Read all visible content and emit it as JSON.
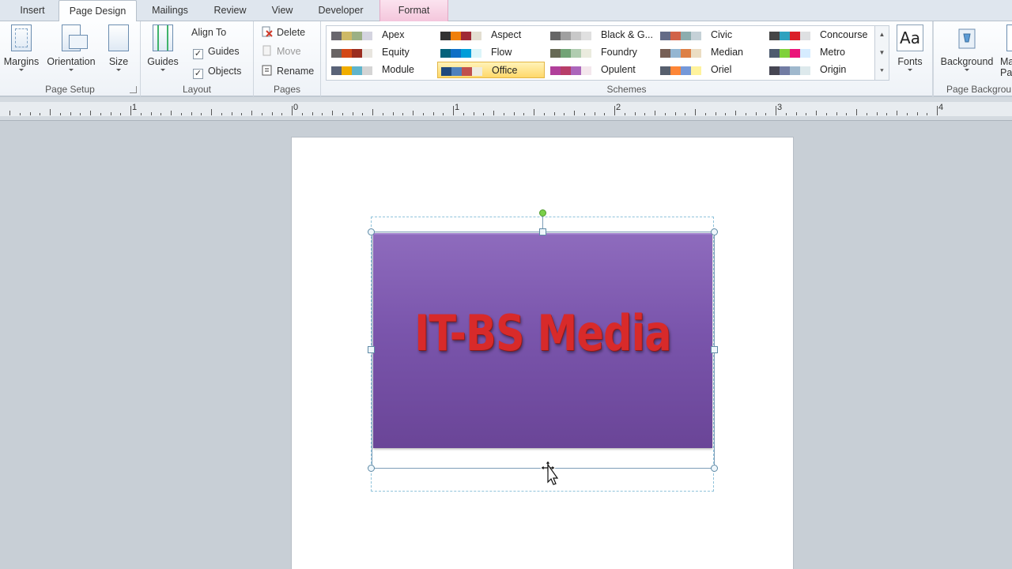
{
  "tabs": [
    {
      "label": "Insert"
    },
    {
      "label": "Page Design",
      "active": true
    },
    {
      "label": "Mailings"
    },
    {
      "label": "Review"
    },
    {
      "label": "View"
    },
    {
      "label": "Developer"
    },
    {
      "label": "Format",
      "contextual": true
    }
  ],
  "page_setup": {
    "label": "Page Setup",
    "margins": "Margins",
    "orientation": "Orientation",
    "size": "Size"
  },
  "layout": {
    "label": "Layout",
    "guides": "Guides",
    "align_to": "Align To",
    "guides_check": "Guides",
    "objects_check": "Objects"
  },
  "pages": {
    "label": "Pages",
    "delete": "Delete",
    "move": "Move",
    "rename": "Rename"
  },
  "schemes": {
    "label": "Schemes",
    "items": [
      {
        "name": "Apex",
        "colors": [
          "#69676d",
          "#ceb966",
          "#9cb084",
          "#d4d4e0"
        ]
      },
      {
        "name": "Equity",
        "colors": [
          "#696464",
          "#d34817",
          "#9b2d1f",
          "#e8e5df"
        ]
      },
      {
        "name": "Module",
        "colors": [
          "#5a6378",
          "#f0ad00",
          "#60b5cc",
          "#d4d4d4"
        ]
      },
      {
        "name": "Aspect",
        "colors": [
          "#323232",
          "#f07f09",
          "#9f2936",
          "#e3ded1"
        ]
      },
      {
        "name": "Flow",
        "colors": [
          "#04617b",
          "#0f6fc6",
          "#009dd9",
          "#dbf5f9"
        ]
      },
      {
        "name": "Office",
        "colors": [
          "#1f497d",
          "#4f81bd",
          "#c0504d",
          "#eeece1"
        ]
      },
      {
        "name": "Black & G...",
        "colors": [
          "#666666",
          "#a0a0a0",
          "#c8c8c8",
          "#e0e0e0"
        ]
      },
      {
        "name": "Foundry",
        "colors": [
          "#676a55",
          "#72a376",
          "#b0ccb0",
          "#eaebde"
        ]
      },
      {
        "name": "Opulent",
        "colors": [
          "#b13f9a",
          "#b83d68",
          "#ac66bb",
          "#f4e7ed"
        ]
      },
      {
        "name": "Civic",
        "colors": [
          "#646b86",
          "#d16349",
          "#8cadae",
          "#c5d1d7"
        ]
      },
      {
        "name": "Median",
        "colors": [
          "#775f55",
          "#94b6d2",
          "#dd8047",
          "#ebddc3"
        ]
      },
      {
        "name": "Oriel",
        "colors": [
          "#575f6d",
          "#fe8637",
          "#7598d9",
          "#fff39d"
        ]
      },
      {
        "name": "Concourse",
        "colors": [
          "#464646",
          "#2da2bf",
          "#da1f28",
          "#dee0e2"
        ]
      },
      {
        "name": "Metro",
        "colors": [
          "#4e5b6f",
          "#7fd13b",
          "#ea157a",
          "#d6ecff"
        ]
      },
      {
        "name": "Origin",
        "colors": [
          "#464653",
          "#727ca3",
          "#9fb8cd",
          "#dde9ec"
        ]
      }
    ],
    "selected": "Office"
  },
  "fonts": {
    "label": "Fonts",
    "icon_text": "Aa"
  },
  "page_background": {
    "label": "Page Backgrou",
    "background": "Background",
    "master_cut_1": "Ma",
    "master_cut_2": "Pag"
  },
  "ruler": {
    "numbers": [
      "1",
      "0",
      "1",
      "2",
      "3",
      "4"
    ]
  },
  "document": {
    "banner_text": "IT-BS Media",
    "banner_color": "#7a55ac",
    "text_color": "#d82a2a"
  }
}
